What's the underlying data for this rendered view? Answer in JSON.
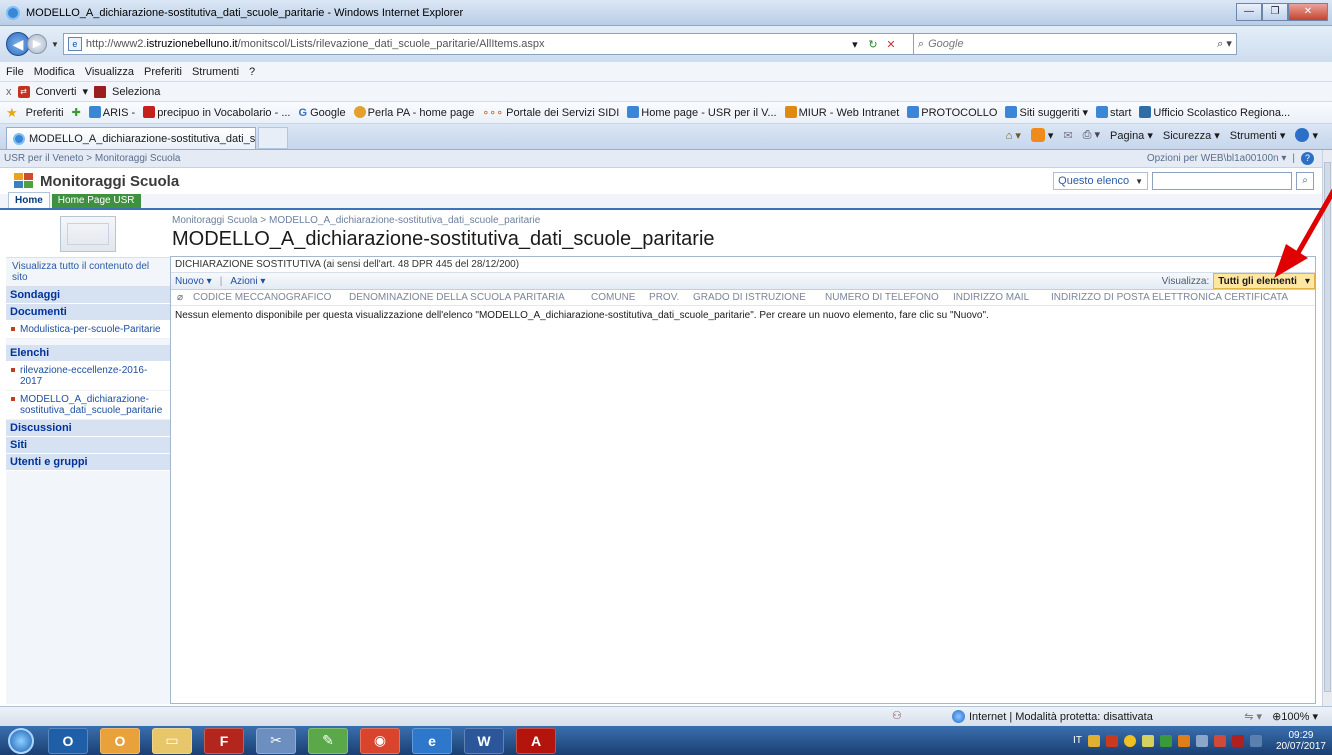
{
  "window": {
    "title": "MODELLO_A_dichiarazione-sostitutiva_dati_scuole_paritarie - Windows Internet Explorer"
  },
  "address": {
    "url_prefix": "http://www2.",
    "url_host": "istruzionebelluno.it",
    "url_path": "/monitscol/Lists/rilevazione_dati_scuole_paritarie/AllItems.aspx",
    "search_placeholder": "Google"
  },
  "menu": [
    "File",
    "Modifica",
    "Visualizza",
    "Preferiti",
    "Strumenti",
    "?"
  ],
  "pdfbar": {
    "close": "x",
    "converti": "Converti",
    "seleziona": "Seleziona"
  },
  "favorites": {
    "label": "Preferiti",
    "items": [
      "ARIS -",
      "precipuo in Vocabolario - ...",
      "Google",
      "Perla PA - home page",
      "Portale dei Servizi SIDI",
      "Home page - USR per il V...",
      "MIUR - Web Intranet",
      "PROTOCOLLO",
      "Siti suggeriti ▾",
      "start",
      "Ufficio Scolastico Regiona..."
    ]
  },
  "tab": {
    "label": "MODELLO_A_dichiarazione-sostitutiva_dati_scuol...",
    "commands": [
      "Pagina ▾",
      "Sicurezza ▾",
      "Strumenti ▾"
    ]
  },
  "sp": {
    "breadcrumb_top": "USR per il Veneto > Monitoraggi Scuola",
    "welcome": "Opzioni per WEB\\bl1a00100n ▾",
    "site_title": "Monitoraggi Scuola",
    "search_scope": "Questo elenco",
    "nav": {
      "home": "Home",
      "usr": "Home Page USR"
    },
    "left": {
      "view_all": "Visualizza tutto il contenuto del sito",
      "sondaggi": "Sondaggi",
      "documenti": "Documenti",
      "doc_items": [
        "Modulistica-per-scuole-Paritarie"
      ],
      "elenchi": "Elenchi",
      "elenchi_items": [
        "rilevazione-eccellenze-2016-2017",
        "MODELLO_A_dichiarazione-sostitutiva_dati_scuole_paritarie"
      ],
      "discussioni": "Discussioni",
      "siti": "Siti",
      "utenti": "Utenti e gruppi"
    },
    "crumbs": "Monitoraggi Scuola > MODELLO_A_dichiarazione-sostitutiva_dati_scuole_paritarie",
    "page_title": "MODELLO_A_dichiarazione-sostitutiva_dati_scuole_paritarie",
    "description": "DICHIARAZIONE SOSTITUTIVA (ai sensi dell'art. 48 DPR 445 del 28/12/200)",
    "toolbar": {
      "nuovo": "Nuovo ▾",
      "azioni": "Azioni ▾",
      "view_label": "Visualizza:",
      "view_value": "Tutti gli elementi"
    },
    "columns": [
      "CODICE MECCANOGRAFICO",
      "DENOMINAZIONE DELLA SCUOLA PARITARIA",
      "COMUNE",
      "PROV.",
      "GRADO DI ISTRUZIONE",
      "NUMERO DI TELEFONO",
      "INDIRIZZO MAIL",
      "INDIRIZZO DI POSTA ELETTRONICA CERTIFICATA"
    ],
    "empty_message": "Nessun elemento disponibile per questa visualizzazione dell'elenco \"MODELLO_A_dichiarazione-sostitutiva_dati_scuole_paritarie\". Per creare un nuovo elemento, fare clic su \"Nuovo\"."
  },
  "status": {
    "zone": "Internet | Modalità protetta: disattivata",
    "zoom": "100%"
  },
  "taskbar": {
    "lang": "IT",
    "time": "09:29",
    "date": "20/07/2017"
  }
}
